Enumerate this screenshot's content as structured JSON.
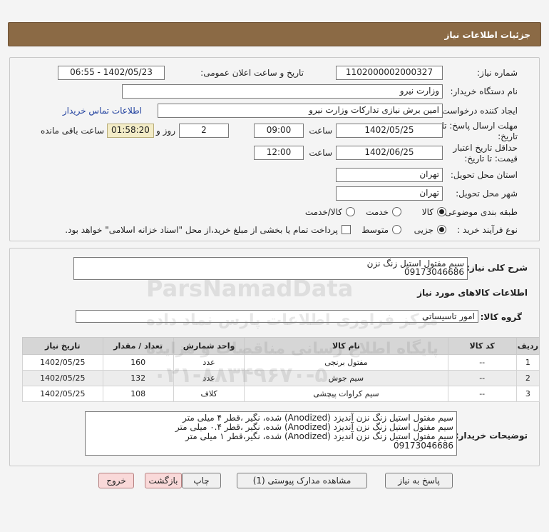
{
  "header": {
    "title": "جزئیات اطلاعات نیاز"
  },
  "form": {
    "need_number_label": "شماره نیاز:",
    "need_number": "1102000002000327",
    "announce_label": "تاریخ و ساعت اعلان عمومی:",
    "announce_value": "1402/05/23 - 06:55",
    "buyer_org_label": "نام دستگاه خریدار:",
    "buyer_org": "وزارت نیرو",
    "requester_label": "ایجاد کننده درخواست:",
    "requester": "امین برش نیازی تدارکات وزارت نیرو",
    "contact_link": "اطلاعات تماس خریدار",
    "reply_deadline_label_1": "مهلت ارسال پاسخ: تا",
    "reply_deadline_label_2": "تاریخ:",
    "reply_date": "1402/05/25",
    "time_label": "ساعت",
    "reply_time": "09:00",
    "days": "2",
    "days_label": "روز و",
    "remaining_time": "01:58:20",
    "remaining_label": "ساعت باقی مانده",
    "price_validity_label_1": "حداقل تاریخ اعتبار",
    "price_validity_label_2": "قیمت: تا تاریخ:",
    "price_date": "1402/06/25",
    "price_time": "12:00",
    "province_label": "استان محل تحویل:",
    "province": "تهران",
    "city_label": "شهر محل تحویل:",
    "city": "تهران",
    "category_label": "طبقه بندی موضوعی:",
    "category_options": [
      "کالا",
      "خدمت",
      "کالا/خدمت"
    ],
    "category_selected": "کالا",
    "process_label": "نوع فرآیند خرید :",
    "process_options": [
      "جزیی",
      "متوسط"
    ],
    "process_selected": "جزیی",
    "payment_note": "پرداخت تمام یا بخشی از مبلغ خرید،از محل \"اسناد خزانه اسلامی\" خواهد بود."
  },
  "summary": {
    "label": "شرح کلی نیاز:",
    "line1": "سیم مفتول استیل زنگ نزن",
    "line2": "09173046686"
  },
  "goods": {
    "section_title": "اطلاعات کالاهای مورد نیاز",
    "group_label": "گروه کالا:",
    "group_value": "امور تاسیساتی",
    "columns": [
      "ردیف",
      "کد کالا",
      "نام کالا",
      "واحد شمارش",
      "تعداد / مقدار",
      "تاریخ نیاز"
    ],
    "rows": [
      {
        "row": "1",
        "code": "--",
        "name": "مفتول برنجی",
        "unit": "عدد",
        "qty": "160",
        "date": "1402/05/25"
      },
      {
        "row": "2",
        "code": "--",
        "name": "سیم جوش",
        "unit": "عدد",
        "qty": "132",
        "date": "1402/05/25"
      },
      {
        "row": "3",
        "code": "--",
        "name": "سیم کراوات پیچشی",
        "unit": "کلاف",
        "qty": "108",
        "date": "1402/05/25"
      }
    ]
  },
  "buyer_notes": {
    "label": "توضیحات خریدار:",
    "line1": "سیم مفتول استیل زنگ نزن آندیزد (Anodized) شده، نگیر ،قطر  ۴  میلی متر",
    "line2": "سیم مفتول استیل زنگ نزن آندیزد (Anodized) شده، نگیر ،قطر  ۰.۴  میلی متر",
    "line3": "سیم مفتول استیل زنگ نزن آندیزد (Anodized) شده، نگیر،قطر  ۱  میلی متر",
    "line4": "09173046686"
  },
  "buttons": {
    "reply": "پاسخ به نیاز",
    "attachments": "مشاهده مدارک پیوستی (1)",
    "print": "چاپ",
    "back": "بازگشت",
    "exit": "خروج"
  },
  "watermark": {
    "brand": "ParsNamadData",
    "line1": "مرکز فراوری اطلاعات پارس نماد داده",
    "line2": "پایگاه اطلاع رسانی مناقصات و مزایده",
    "phone": "۰۲۱-۸۸۳۴۹۶۷۰-۵"
  }
}
